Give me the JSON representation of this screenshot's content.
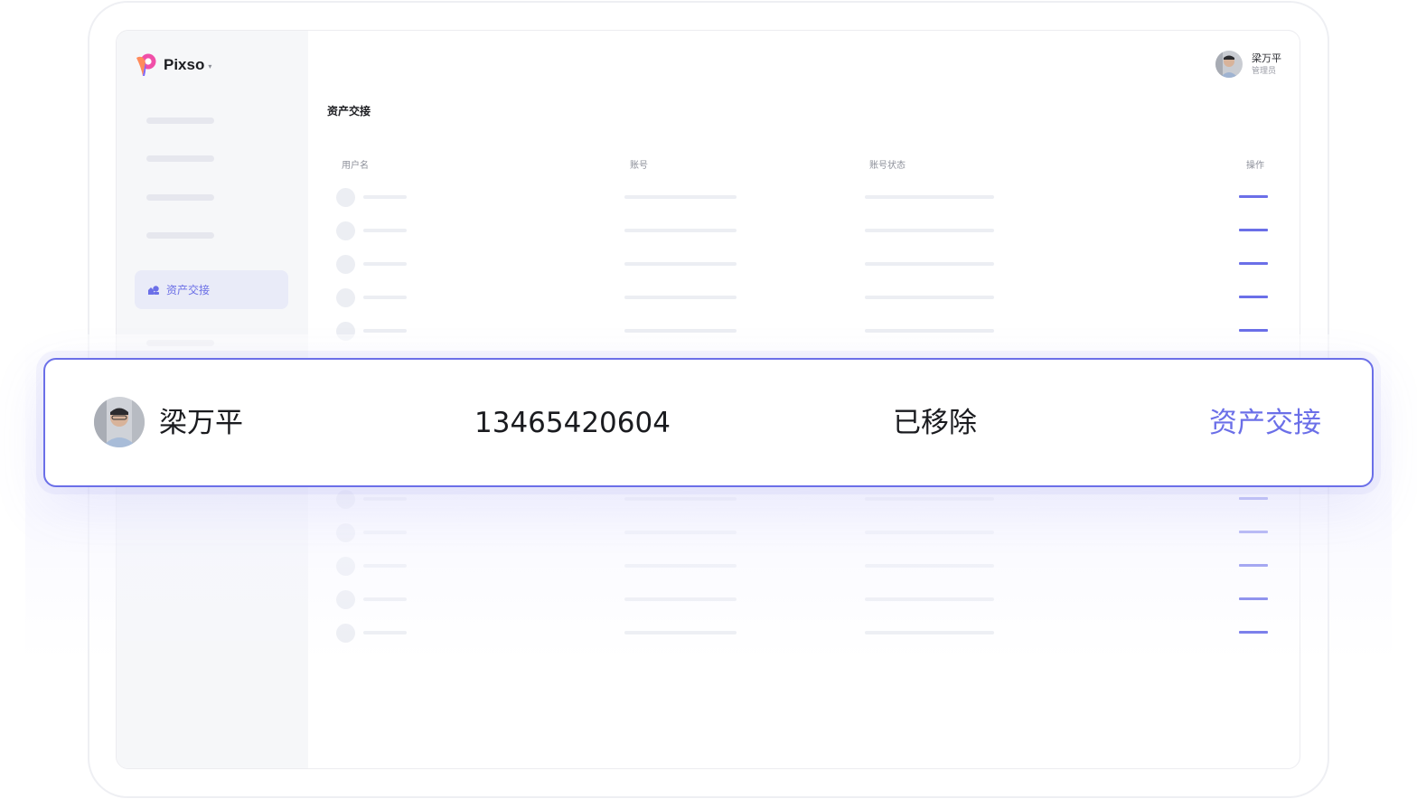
{
  "brand": {
    "name": "Pixso",
    "caret": "▾",
    "accent": "#6b6fe8"
  },
  "header_user": {
    "name": "梁万平",
    "role": "管理员"
  },
  "sidebar": {
    "active_item": {
      "label": "资产交接",
      "icon": "asset-handover-icon"
    }
  },
  "page": {
    "title": "资产交接"
  },
  "table": {
    "columns": [
      "用户名",
      "账号",
      "账号状态",
      "操作"
    ]
  },
  "highlight_row": {
    "username": "梁万平",
    "account": "13465420604",
    "status": "已移除",
    "action": "资产交接"
  }
}
